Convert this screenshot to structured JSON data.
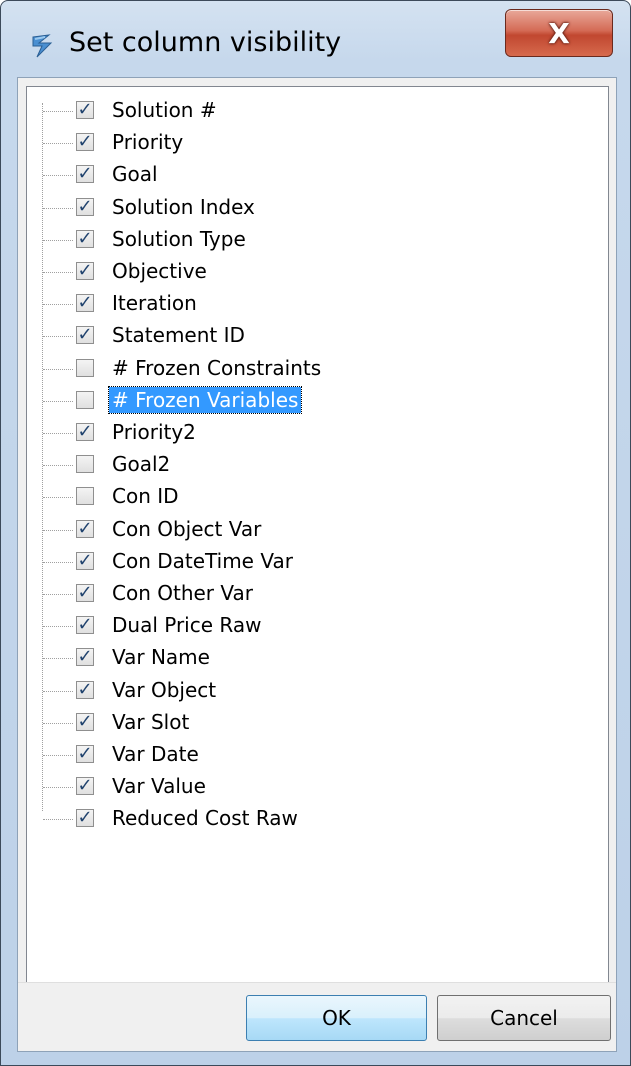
{
  "window": {
    "title": "Set column visibility",
    "close_label": "X"
  },
  "columns": [
    {
      "label": "Solution #",
      "checked": true
    },
    {
      "label": "Priority",
      "checked": true
    },
    {
      "label": "Goal",
      "checked": true
    },
    {
      "label": "Solution Index",
      "checked": true
    },
    {
      "label": "Solution Type",
      "checked": true
    },
    {
      "label": "Objective",
      "checked": true
    },
    {
      "label": "Iteration",
      "checked": true
    },
    {
      "label": "Statement ID",
      "checked": true
    },
    {
      "label": "# Frozen Constraints",
      "checked": false
    },
    {
      "label": "# Frozen Variables",
      "checked": false,
      "selected": true
    },
    {
      "label": "Priority2",
      "checked": true
    },
    {
      "label": "Goal2",
      "checked": false
    },
    {
      "label": "Con ID",
      "checked": false
    },
    {
      "label": "Con Object Var",
      "checked": true
    },
    {
      "label": "Con DateTime Var",
      "checked": true
    },
    {
      "label": "Con Other Var",
      "checked": true
    },
    {
      "label": "Dual Price Raw",
      "checked": true
    },
    {
      "label": "Var Name",
      "checked": true
    },
    {
      "label": "Var Object",
      "checked": true
    },
    {
      "label": "Var Slot",
      "checked": true
    },
    {
      "label": "Var Date",
      "checked": true
    },
    {
      "label": "Var Value",
      "checked": true
    },
    {
      "label": "Reduced Cost Raw",
      "checked": true
    }
  ],
  "buttons": {
    "ok_label": "OK",
    "cancel_label": "Cancel"
  },
  "icons": {
    "app": "app-logo-icon",
    "check": "checkmark-icon"
  },
  "colors": {
    "selection": "#3399ff",
    "check": "#21436e",
    "close_button": "#c14730"
  }
}
